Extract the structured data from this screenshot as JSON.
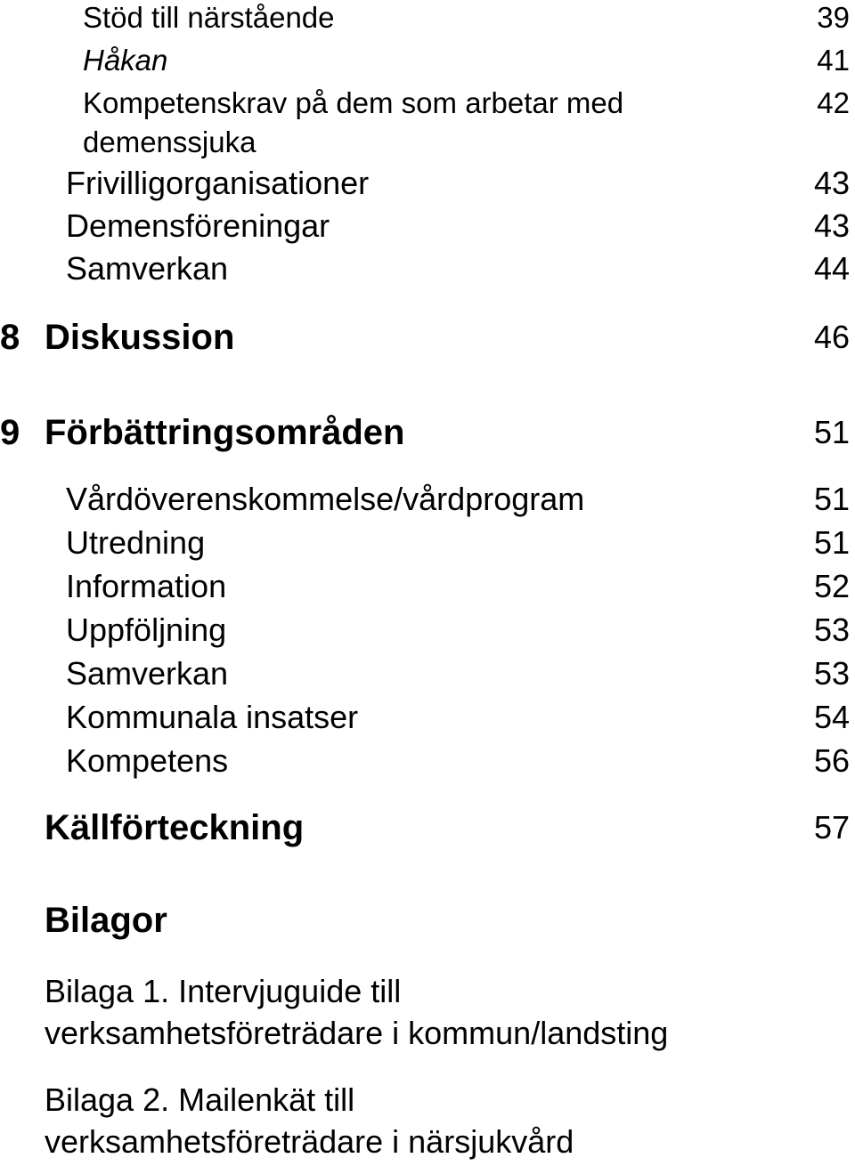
{
  "toc": {
    "level3": [
      {
        "title": "Stöd till närstående",
        "page": "39"
      },
      {
        "title": "Håkan",
        "page": "41"
      },
      {
        "title_line1": "Kompetenskrav på dem som arbetar med",
        "title_line2": "demenssjuka",
        "page": "42"
      }
    ],
    "level2_a": [
      {
        "title": "Frivilligorganisationer",
        "page": "43"
      },
      {
        "title": "Demensföreningar",
        "page": "43"
      },
      {
        "title": "Samverkan",
        "page": "44"
      }
    ],
    "chapters": [
      {
        "number": "8",
        "title": "Diskussion",
        "page": "46"
      },
      {
        "number": "9",
        "title": "Förbättringsområden",
        "page": "51"
      }
    ],
    "level2_b": [
      {
        "title": "Vårdöverenskommelse/vårdprogram",
        "page": "51"
      },
      {
        "title": "Utredning",
        "page": "51"
      },
      {
        "title": "Information",
        "page": "52"
      },
      {
        "title": "Uppföljning",
        "page": "53"
      },
      {
        "title": "Samverkan",
        "page": "53"
      },
      {
        "title": "Kommunala insatser",
        "page": "54"
      },
      {
        "title": "Kompetens",
        "page": "56"
      }
    ],
    "references": {
      "title": "Källförteckning",
      "page": "57"
    },
    "appendices": {
      "heading": "Bilagor",
      "items": [
        {
          "line1": "Bilaga 1. Intervjuguide till",
          "line2": "verksamhetsföreträdare i kommun/landsting"
        },
        {
          "line1": "Bilaga 2. Mailenkät till",
          "line2": "verksamhetsföreträdare i närsjukvård"
        }
      ]
    }
  }
}
